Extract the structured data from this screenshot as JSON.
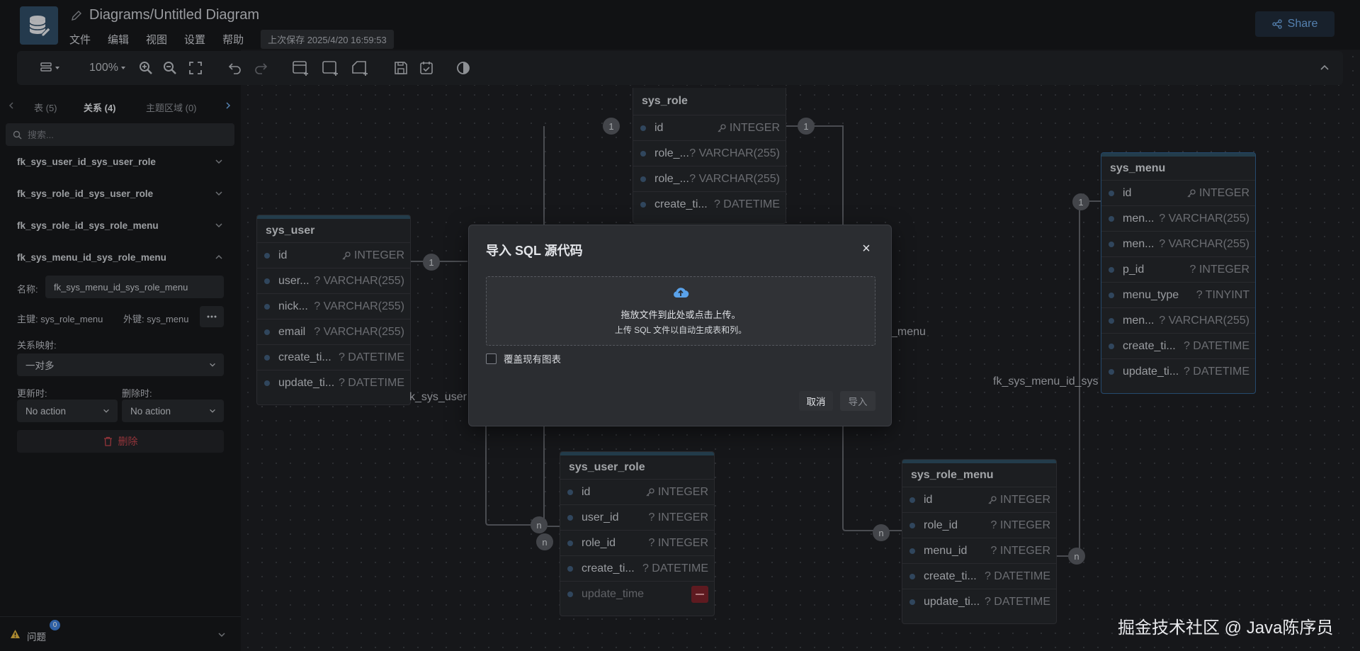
{
  "header": {
    "title": "Diagrams/Untitled Diagram",
    "menu": [
      "文件",
      "编辑",
      "视图",
      "设置",
      "帮助"
    ],
    "save_status": "上次保存 2025/4/20 16:59:53",
    "share_label": "Share"
  },
  "toolbar": {
    "zoom": "100%"
  },
  "sidebar": {
    "tabs": [
      "表 (5)",
      "关系 (4)",
      "主题区域 (0)"
    ],
    "search_placeholder": "搜索...",
    "relationships": [
      "fk_sys_user_id_sys_user_role",
      "fk_sys_role_id_sys_user_role",
      "fk_sys_role_id_sys_role_menu",
      "fk_sys_menu_id_sys_role_menu"
    ],
    "detail": {
      "name_label": "名称:",
      "name_value": "fk_sys_menu_id_sys_role_menu",
      "primary_label": "主键: sys_role_menu",
      "foreign_label": "外键: sys_menu",
      "mapping_label": "关系映射:",
      "mapping_value": "一对多",
      "on_update_label": "更新时:",
      "on_delete_label": "删除时:",
      "on_update_value": "No action",
      "on_delete_value": "No action",
      "delete_label": "删除"
    },
    "issues_label": "问题",
    "issues_count": "0"
  },
  "tables": {
    "sys_role": {
      "name": "sys_role",
      "rows": [
        {
          "name": "id",
          "type": "INTEGER"
        },
        {
          "name": "role_...",
          "type": "? VARCHAR(255)"
        },
        {
          "name": "role_...",
          "type": "? VARCHAR(255)"
        },
        {
          "name": "create_ti...",
          "type": "? DATETIME"
        }
      ]
    },
    "sys_user": {
      "name": "sys_user",
      "rows": [
        {
          "name": "id",
          "type": "INTEGER"
        },
        {
          "name": "user...",
          "type": "? VARCHAR(255)"
        },
        {
          "name": "nick...",
          "type": "? VARCHAR(255)"
        },
        {
          "name": "email",
          "type": "? VARCHAR(255)"
        },
        {
          "name": "create_ti...",
          "type": "? DATETIME"
        },
        {
          "name": "update_ti...",
          "type": "? DATETIME"
        }
      ]
    },
    "sys_menu": {
      "name": "sys_menu",
      "rows": [
        {
          "name": "id",
          "type": "INTEGER"
        },
        {
          "name": "men...",
          "type": "? VARCHAR(255)"
        },
        {
          "name": "men...",
          "type": "? VARCHAR(255)"
        },
        {
          "name": "p_id",
          "type": "? INTEGER"
        },
        {
          "name": "menu_type",
          "type": "? TINYINT"
        },
        {
          "name": "men...",
          "type": "? VARCHAR(255)"
        },
        {
          "name": "create_ti...",
          "type": "? DATETIME"
        },
        {
          "name": "update_ti...",
          "type": "? DATETIME"
        }
      ]
    },
    "sys_user_role": {
      "name": "sys_user_role",
      "rows": [
        {
          "name": "id",
          "type": "INTEGER"
        },
        {
          "name": "user_id",
          "type": "? INTEGER"
        },
        {
          "name": "role_id",
          "type": "? INTEGER"
        },
        {
          "name": "create_ti...",
          "type": "? DATETIME"
        },
        {
          "name": "update_time",
          "type": ""
        }
      ]
    },
    "sys_role_menu": {
      "name": "sys_role_menu",
      "rows": [
        {
          "name": "id",
          "type": "INTEGER"
        },
        {
          "name": "role_id",
          "type": "? INTEGER"
        },
        {
          "name": "menu_id",
          "type": "? INTEGER"
        },
        {
          "name": "create_ti...",
          "type": "? DATETIME"
        },
        {
          "name": "update_ti...",
          "type": "? DATETIME"
        }
      ]
    }
  },
  "canvas": {
    "badge_one": "1",
    "badge_many": "n",
    "label_menu": "_menu",
    "label_sys_user": "k_sys_user",
    "label_menu_id": "fk_sys_menu_id_sys"
  },
  "modal": {
    "title": "导入 SQL 源代码",
    "close": "×",
    "drop_line1": "拖放文件到此处或点击上传。",
    "drop_line2": "上传 SQL 文件以自动生成表和列。",
    "overwrite_label": "覆盖现有图表",
    "cancel_label": "取消",
    "import_label": "导入"
  },
  "watermark": "掘金技术社区 @ Java陈序员"
}
